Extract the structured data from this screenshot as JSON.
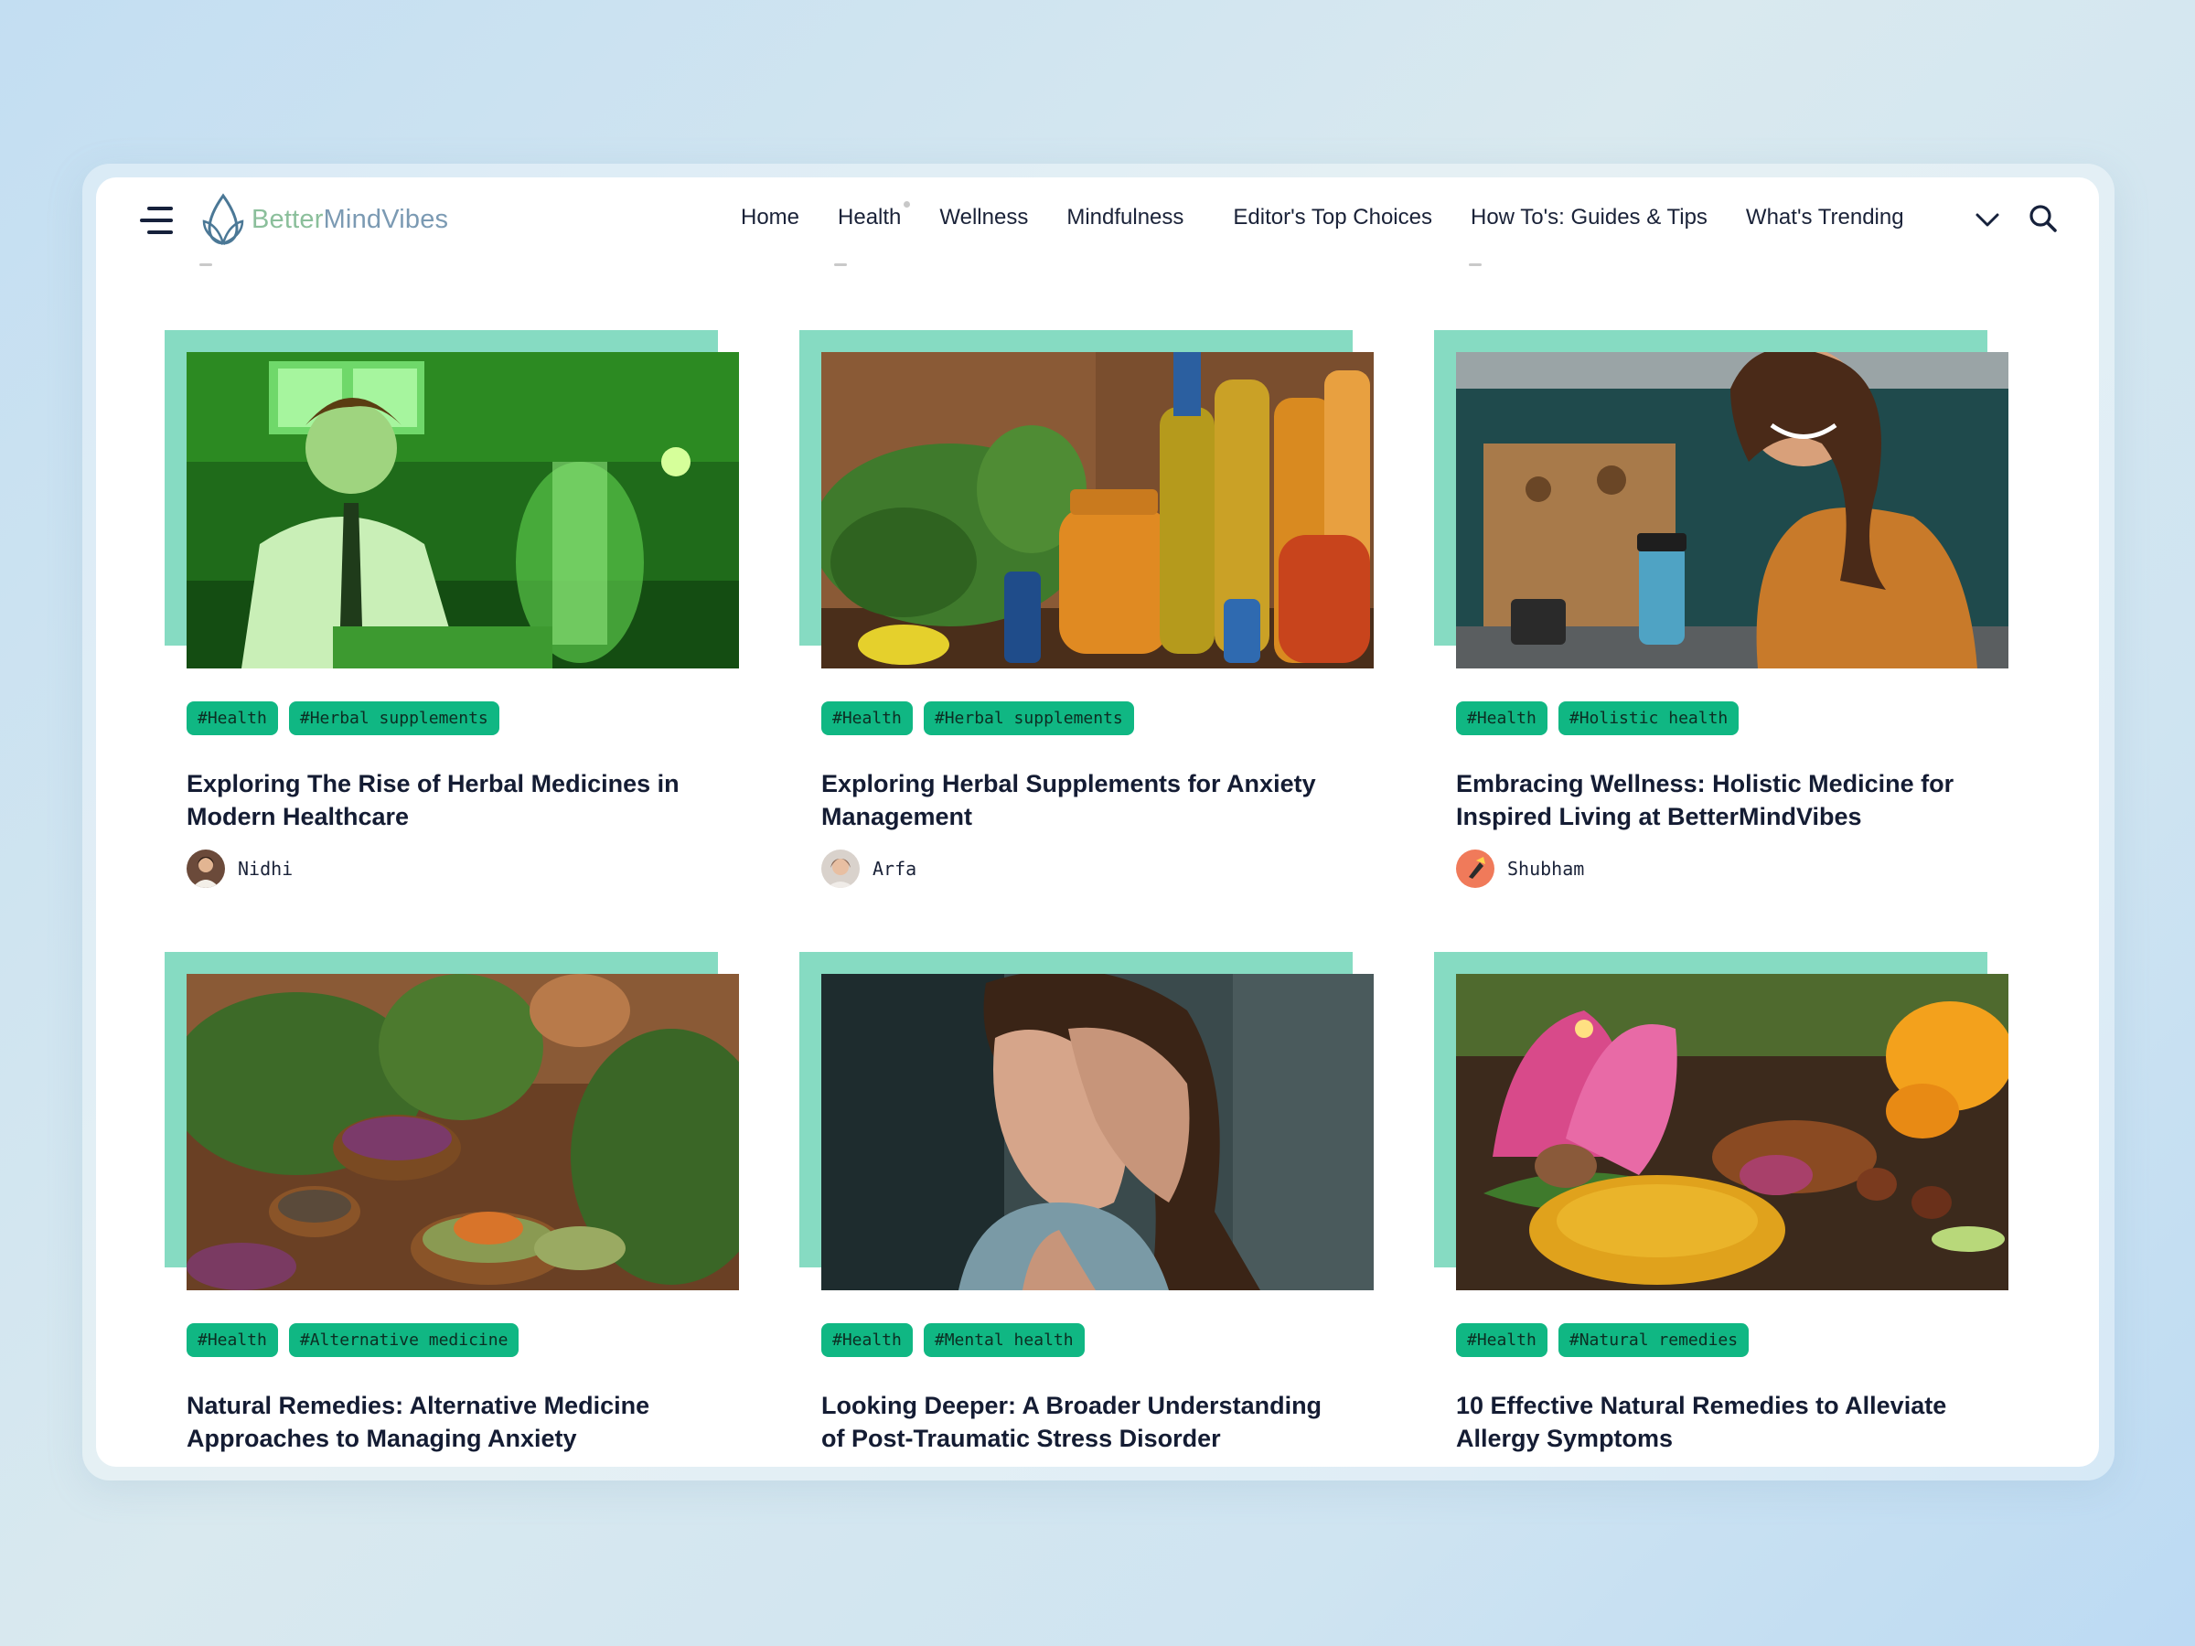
{
  "header": {
    "logo": {
      "part1": "Better",
      "part2": "MindVibes"
    },
    "nav": [
      "Home",
      "Health",
      "Wellness",
      "Mindfulness",
      "Editor's Top Choices",
      "How To's: Guides & Tips",
      "What's Trending"
    ]
  },
  "articles": [
    {
      "tags": [
        "#Health",
        "#Herbal supplements"
      ],
      "title": "Exploring The Rise of Herbal Medicines in Modern Healthcare",
      "author": "Nidhi",
      "image": "scientist-lab-photo"
    },
    {
      "tags": [
        "#Health",
        "#Herbal supplements"
      ],
      "title": "Exploring Herbal Supplements for Anxiety Management",
      "author": "Arfa",
      "image": "herbal-bottles-photo"
    },
    {
      "tags": [
        "#Health",
        "#Holistic health"
      ],
      "title": "Embracing Wellness: Holistic Medicine for Inspired Living at BetterMindVibes",
      "author": "Shubham",
      "image": "woman-kitchen-photo"
    },
    {
      "tags": [
        "#Health",
        "#Alternative medicine"
      ],
      "title": "Natural Remedies: Alternative Medicine Approaches to Managing Anxiety",
      "author": "",
      "image": "herbs-bowls-photo"
    },
    {
      "tags": [
        "#Health",
        "#Mental health"
      ],
      "title": "Looking Deeper: A Broader Understanding of Post-Traumatic Stress Disorder",
      "author": "",
      "image": "stressed-woman-photo"
    },
    {
      "tags": [
        "#Health",
        "#Natural remedies"
      ],
      "title": "10 Effective Natural Remedies to Alleviate Allergy Symptoms",
      "author": "",
      "image": "spices-lotus-photo"
    }
  ],
  "colors": {
    "accent": "#86dbc2",
    "tag_bg": "#10b783",
    "text": "#141c33"
  }
}
